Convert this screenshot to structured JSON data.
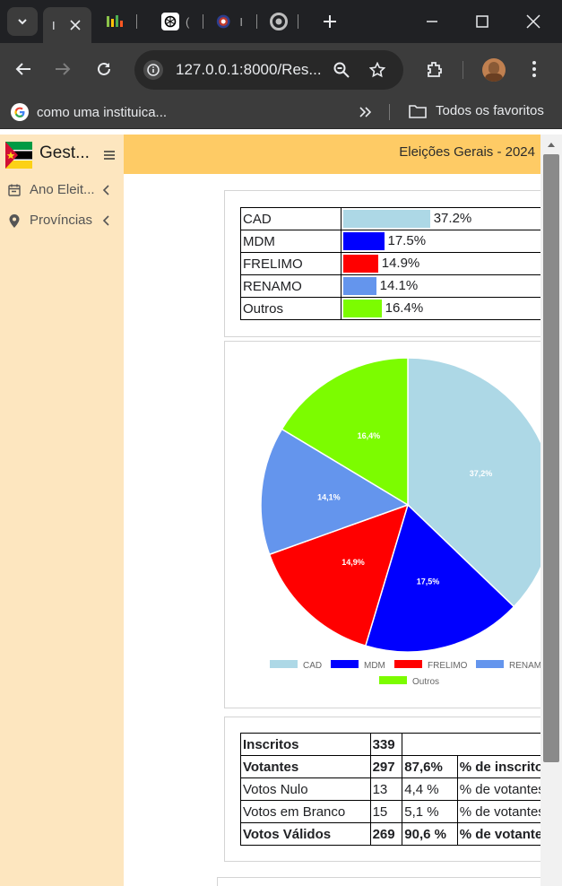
{
  "browser": {
    "tabs": [
      {
        "label": "I"
      },
      {
        "label": ""
      },
      {
        "label": "("
      },
      {
        "label": "I"
      },
      {
        "label": ""
      }
    ],
    "address": "127.0.0.1:8000/Res...",
    "bookmark": "como uma instituica...",
    "all_bookmarks": "Todos os favoritos",
    "colors": {
      "tab_bg": "#202124",
      "toolbar_bg": "#3c3c3c"
    }
  },
  "app": {
    "brand": "Gest...",
    "header_title": "Eleições Gerais - 2024",
    "sidebar": [
      {
        "label": "Ano Eleit...",
        "icon": "calendar-icon"
      },
      {
        "label": "Províncias",
        "icon": "map-pin-icon"
      }
    ],
    "colors": {
      "sidebar_bg": "#fde6bf",
      "header_bg": "#fecb65"
    }
  },
  "results": [
    {
      "party": "CAD",
      "pct_label": "37.2%",
      "pct": 37.2,
      "color": "#add8e6"
    },
    {
      "party": "MDM",
      "pct_label": "17.5%",
      "pct": 17.5,
      "color": "#0000ff"
    },
    {
      "party": "FRELIMO",
      "pct_label": "14.9%",
      "pct": 14.9,
      "color": "#ff0000"
    },
    {
      "party": "RENAMO",
      "pct_label": "14.1%",
      "pct": 14.1,
      "color": "#6495ed"
    },
    {
      "party": "Outros",
      "pct_label": "16.4%",
      "pct": 16.4,
      "color": "#7cfc00"
    }
  ],
  "chart_data": {
    "type": "pie",
    "categories": [
      "CAD",
      "MDM",
      "FRELIMO",
      "RENAMO",
      "Outros"
    ],
    "values": [
      37.2,
      17.5,
      14.9,
      14.1,
      16.4
    ],
    "slice_labels": [
      "37,2%",
      "17,5%",
      "14,9%",
      "14,1%",
      "16,4%"
    ],
    "colors": [
      "#add8e6",
      "#0000ff",
      "#ff0000",
      "#6495ed",
      "#7cfc00"
    ],
    "legend": "bottom"
  },
  "stats": [
    {
      "label": "Inscritos",
      "value": "339",
      "pct": "",
      "ref": "",
      "bold": true
    },
    {
      "label": "Votantes",
      "value": "297",
      "pct": "87,6%",
      "ref": "% de inscritos",
      "bold": true
    },
    {
      "label": "Votos Nulo",
      "value": "13",
      "pct": "4,4 %",
      "ref": "% de votantes",
      "bold": false
    },
    {
      "label": "Votos em Branco",
      "value": "15",
      "pct": "5,1 %",
      "ref": "% de votantes",
      "bold": false
    },
    {
      "label": "Votos Válidos",
      "value": "269",
      "pct": "90,6 %",
      "ref": "% de votantes",
      "bold": true
    }
  ]
}
